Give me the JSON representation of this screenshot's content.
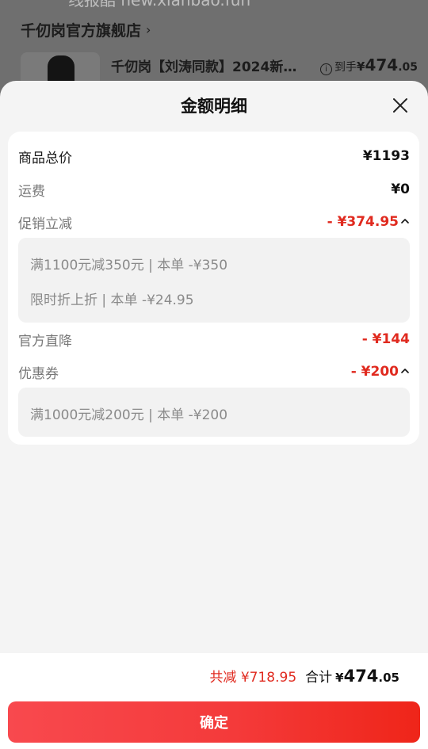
{
  "background": {
    "watermark": "线报酷 new.xianbao.fun",
    "store_name": "千仞岗官方旗舰店",
    "product_title": "千仞岗【刘涛同款】2024新…",
    "price_label": "到手",
    "price_currency": "¥",
    "price_int": "474",
    "price_dec": ".05"
  },
  "sheet": {
    "title": "金额明细"
  },
  "breakdown": {
    "goods_total": {
      "label": "商品总价",
      "value": "¥1193"
    },
    "shipping": {
      "label": "运费",
      "value": "¥0"
    },
    "promo": {
      "label": "促销立减",
      "value": "- ¥374.95",
      "details": [
        "满1100元减350元 | 本单 -¥350",
        "限时折上折 | 本单 -¥24.95"
      ]
    },
    "official_discount": {
      "label": "官方直降",
      "value": "- ¥144"
    },
    "coupon": {
      "label": "优惠券",
      "value": "- ¥200",
      "details": [
        "满1000元减200元 | 本单 -¥200"
      ]
    }
  },
  "footer": {
    "saved": "共减 ¥718.95",
    "total_label": "合计",
    "total_currency": "¥",
    "total_int": "474",
    "total_dec": ".05",
    "confirm_label": "确定"
  },
  "colors": {
    "accent_red": "#e02a1f",
    "button_gradient_start": "#f8494e",
    "button_gradient_end": "#ef2519"
  },
  "icons": {
    "close": "close-icon",
    "collapse": "chevron-up-icon",
    "store_arrow": "chevron-right-icon",
    "info": "info-icon"
  }
}
